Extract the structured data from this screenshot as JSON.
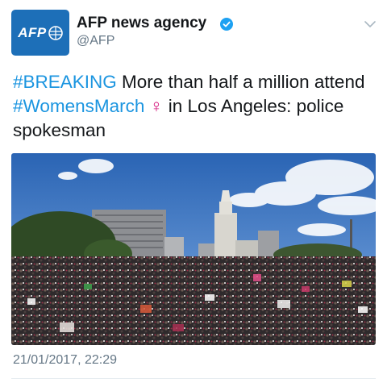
{
  "account": {
    "display_name": "AFP news agency",
    "handle": "@AFP",
    "avatar_text": "AFP",
    "verified": true,
    "avatar_color": "#1d6fb8"
  },
  "tweet": {
    "hashtag_breaking": "#BREAKING",
    "text_part1": " More than half a million attend ",
    "hashtag_march": "#WomensMarch",
    "emoji": "♀",
    "text_part2": " in Los Angeles: police spokesman",
    "hashtag_color": "#1b95e0"
  },
  "media": {
    "icon": "photo-crowd-los-angeles"
  },
  "meta": {
    "timestamp": "21/01/2017, 22:29"
  },
  "icons": {
    "verified": "verified-badge-icon",
    "menu": "chevron-down-icon"
  }
}
